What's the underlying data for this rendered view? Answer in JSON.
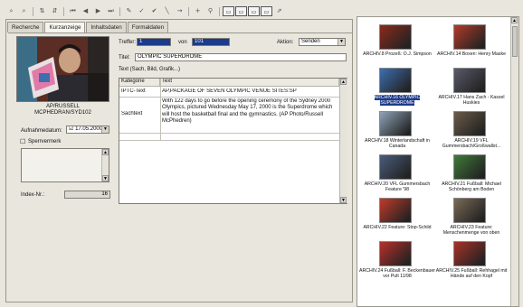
{
  "colors": {
    "selection": "#1d3b8a",
    "chrome": "#e9e6de",
    "panel_border": "#9a978f"
  },
  "toolbar": {
    "icons": [
      "binoculars-icon",
      "binoculars-next-icon",
      "sort-az-icon",
      "sort-za-icon",
      "first-record-icon",
      "prev-record-icon",
      "next-record-icon",
      "last-record-icon",
      "edit-icon",
      "check-icon",
      "check2-icon",
      "line-icon",
      "arrow-icon",
      "plus-icon",
      "pin-icon",
      "view1-icon",
      "view2-icon",
      "view3-icon",
      "view4-icon",
      "export-icon"
    ]
  },
  "tabs": [
    {
      "label": "Recherche"
    },
    {
      "label": "Kurzanzeige"
    },
    {
      "label": "Inhaltsdaten"
    },
    {
      "label": "Formaldaten"
    }
  ],
  "photo": {
    "caption_line1": "AP/RUSSELL",
    "caption_line2": "MCPHEDRAN/SYD102"
  },
  "form": {
    "treffer_label": "Treffer:",
    "treffer_value": "1",
    "von_label": "von",
    "von_value": "101",
    "aktion_label": "Aktion:",
    "aktion_value": "Senden",
    "titel_label": "Titel:",
    "titel_value": "OLYMPIC SUPERDROME",
    "text_group_label": "Text (Sach, Bild, Grafik...)",
    "aufnahmedatum_label": "Aufnahmedatum:",
    "aufnahmedatum_value": "17.05.2000",
    "sperrvermerk_label": "Sperrvermerk",
    "index_label": "Index-Nr.:",
    "index_value": "16"
  },
  "kw_table": {
    "headers": [
      "Kategorie",
      "Text"
    ],
    "rows": [
      {
        "kategorie": "IPTC-Text",
        "text": "AP,PACKAGE OF SEVEN OLYMPIC VENUE SITES:SP"
      },
      {
        "kategorie": "Sachtext",
        "text": "With 122 days to go before the opening ceremony of the Sydney 2000 Olympics, pictured Wednesday May 17, 2000 is the Superdrome which will host the basketball final and the gymnastics. (AP Photo/Russell McPhedren)"
      }
    ]
  },
  "thumbnails": [
    {
      "caption": "ARCHIV.8 Prozeß: O.J. Simpson",
      "color": "#8b2a1c",
      "selected": false
    },
    {
      "caption": "ARCHIV.14 Boxen: Henry Maske",
      "color": "#b33a28",
      "selected": false
    },
    {
      "caption": "ARCHIV.16 OLYMPIC SUPERDROME",
      "color": "#3d6fb0",
      "selected": true
    },
    {
      "caption": "ARCHIV.17 Hans Zach - Kassel Huskies",
      "color": "#5a5a6a",
      "selected": false
    },
    {
      "caption": "ARCHIV.18 Winterlandschaft in Canada",
      "color": "#8fa3b8",
      "selected": false
    },
    {
      "caption": "ARCHIV.19 VFL Gummersbach/Großwallst...",
      "color": "#6b5b4a",
      "selected": false
    },
    {
      "caption": "ARCHIV.20 VFL Gummersbach Feature '98",
      "color": "#4a5c7a",
      "selected": false
    },
    {
      "caption": "ARCHIV.21 Fußball: Michael Schönberg am Boden",
      "color": "#3f7a3a",
      "selected": false
    },
    {
      "caption": "ARCHIV.22 Feature: Stop-Schild",
      "color": "#c23a2a",
      "selected": false
    },
    {
      "caption": "ARCHIV.23 Feature: Menschenmenge von oben",
      "color": "#7a6a55",
      "selected": false
    },
    {
      "caption": "ARCHIV.24 Fußball: F. Beckenbauer vor Pult 11/98",
      "color": "#b8302a",
      "selected": false
    },
    {
      "caption": "ARCHIV.25 Fußball: Rehhagel mit Hände auf den Kopf",
      "color": "#a83228",
      "selected": false
    }
  ]
}
